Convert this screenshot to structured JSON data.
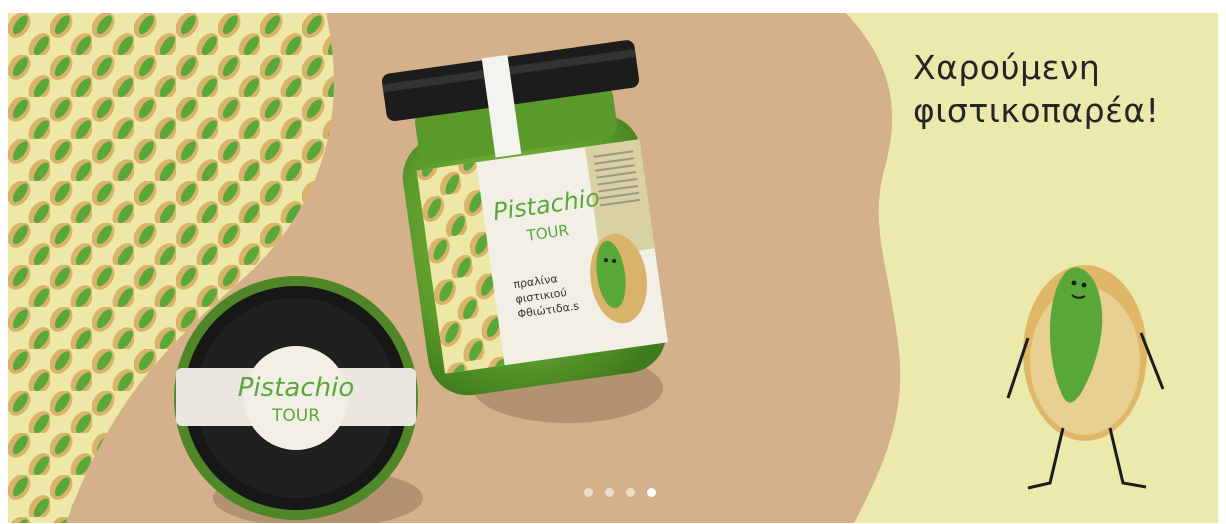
{
  "hero": {
    "headline_line1": "Χαρούμενη",
    "headline_line2": "φιστικοπαρέα!"
  },
  "product_label": {
    "brand_word1": "Pistachio",
    "brand_word2": "TOUR",
    "description_line1": "πραλίνα",
    "description_line2": "φιστικιού",
    "description_line3": "Φθιώτιδα.s"
  },
  "carousel": {
    "slide_count": 4,
    "active_index": 3
  },
  "colors": {
    "background_tan": "#d4b18a",
    "pattern_cream": "#ede8a8",
    "right_panel": "#ece9ad",
    "pistachio_green": "#5aa83a",
    "shell_tan": "#d9b36a"
  },
  "icons": [
    "pistachio-pattern",
    "pistachio-mascot",
    "dot-indicator"
  ]
}
